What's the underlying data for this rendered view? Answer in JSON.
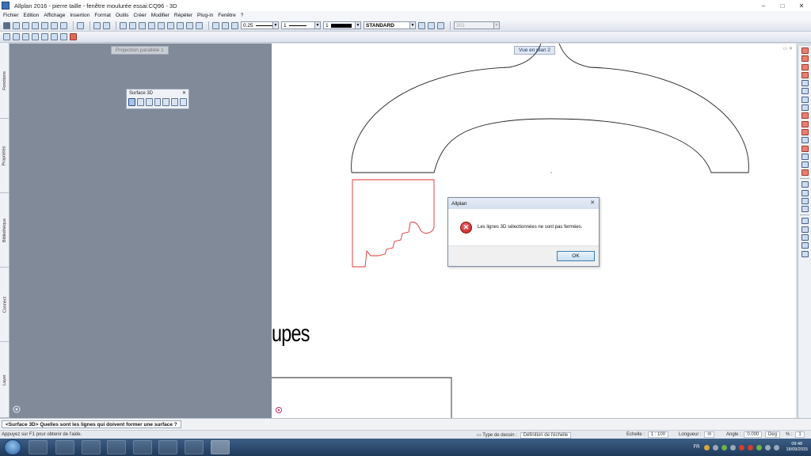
{
  "window": {
    "title": "Allplan 2016 - pierre taille - fenêtre moulurée essai:CQ96 - 3D",
    "min_label": "–",
    "max_label": "□",
    "close_label": "✕"
  },
  "menu": [
    "Fichier",
    "Edition",
    "Affichage",
    "Insertion",
    "Format",
    "Outils",
    "Créer",
    "Modifier",
    "Répéter",
    "Plug-in",
    "Fenêtre",
    "?"
  ],
  "format_bar": {
    "thickness": "0.25",
    "linetype": "1",
    "pen": "1",
    "layer": "STANDARD",
    "drawing_file": "301"
  },
  "left_tabs": [
    "Fonctions",
    "Propriétés",
    "Bibliothèque",
    "Connect",
    "Layer"
  ],
  "viewports": {
    "left_label": "Projection parallèle 1",
    "right_label": "Vue en plan 2"
  },
  "palette": {
    "title": "Surface 3D",
    "close_label": "✕"
  },
  "dialog": {
    "title": "Allplan",
    "close_label": "✕",
    "message": "Les lignes 3D sélectionnées ne sont pas fermées.",
    "ok_label": "OK"
  },
  "drawing": {
    "text_fragment": "upes"
  },
  "prompt": "<Surface 3D> Quelles sont les lignes qui doivent former une surface ?",
  "status": {
    "help": "Appuyez sur F1 pour obtenir de l'aide.",
    "drawing_type_label": "Type de dessin :",
    "drawing_type_value": "Définition de l'échelle",
    "scale_label": "Echelle :",
    "scale_value": "1 : 100",
    "length_label": "Longueur :",
    "length_value": "m",
    "angle_label": "Angle :",
    "angle_value": "0.000",
    "angle_unit": "Deg",
    "percent_label": "% :",
    "percent_value": "1"
  },
  "taskbar": {
    "lang": "FR",
    "time": "09:48",
    "date": "18/09/2015"
  },
  "colors": {
    "viewport_bg": "#808a99",
    "drawing_red": "#e23030",
    "error_red": "#c01818"
  }
}
